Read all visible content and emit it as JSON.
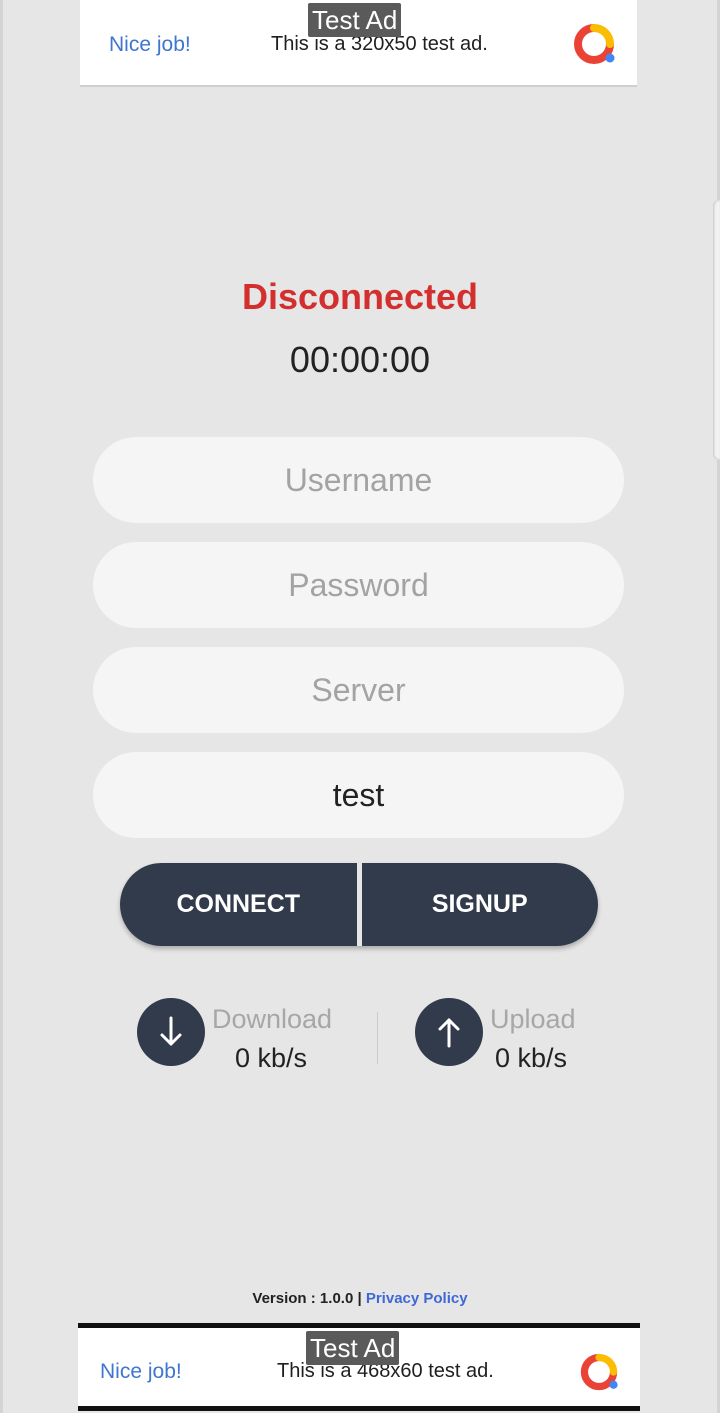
{
  "ad_top": {
    "badge": "Test Ad",
    "nice": "Nice job!",
    "text": "This is a 320x50 test ad.",
    "logo_icon": "google-ads-logo-icon"
  },
  "status": {
    "label": "Disconnected",
    "timer": "00:00:00",
    "color": "#d32f2f"
  },
  "form": {
    "username_placeholder": "Username",
    "password_placeholder": "Password",
    "server_placeholder": "Server",
    "extra_value": "test"
  },
  "buttons": {
    "connect": "CONNECT",
    "signup": "SIGNUP",
    "color": "#323b4b"
  },
  "stats": {
    "download_label": "Download",
    "download_value": "0 kb/s",
    "download_icon": "arrow-down-icon",
    "upload_label": "Upload",
    "upload_value": "0 kb/s",
    "upload_icon": "arrow-up-icon"
  },
  "footer": {
    "version": "Version : 1.0.0",
    "separator": "|",
    "privacy": "Privacy Policy"
  },
  "ad_bottom": {
    "badge": "Test Ad",
    "nice": "Nice job!",
    "text": "This is a 468x60 test ad.",
    "logo_icon": "google-ads-logo-icon"
  }
}
